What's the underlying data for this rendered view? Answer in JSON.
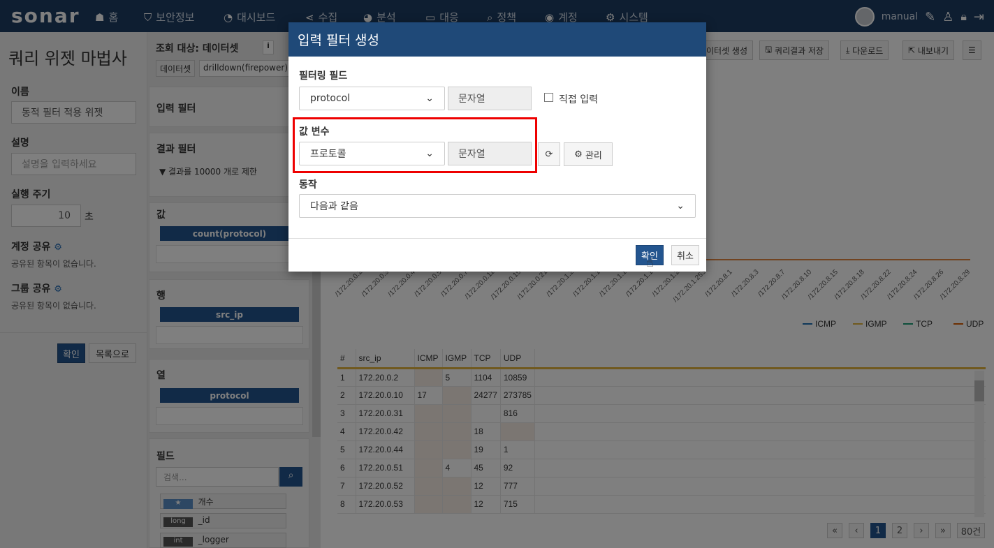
{
  "nav": {
    "logo": "sonar",
    "items": [
      {
        "label": "홈",
        "icon": "home-icon",
        "glyph": "☗"
      },
      {
        "label": "보안정보",
        "icon": "shield-icon",
        "glyph": "⛉"
      },
      {
        "label": "대시보드",
        "icon": "dashboard-icon",
        "glyph": "◔"
      },
      {
        "label": "수집",
        "icon": "share-icon",
        "glyph": "⋖"
      },
      {
        "label": "분석",
        "icon": "pie-chart-icon",
        "glyph": "◕"
      },
      {
        "label": "대응",
        "icon": "monitor-icon",
        "glyph": "▭"
      },
      {
        "label": "정책",
        "icon": "search-icon",
        "glyph": "⌕"
      },
      {
        "label": "계정",
        "icon": "user-circle-icon",
        "glyph": "◉"
      },
      {
        "label": "시스템",
        "icon": "gear-icon",
        "glyph": "⚙"
      }
    ],
    "user": "manual"
  },
  "left": {
    "title": "쿼리 위젯 마법사",
    "name_label": "이름",
    "name_value": "동적 필터 적용 위젯",
    "desc_label": "설명",
    "desc_placeholder": "설명을 입력하세요",
    "interval_label": "실행 주기",
    "interval_value": "10",
    "interval_unit": "초",
    "account_share_label": "계정 공유",
    "account_share_empty": "공유된 항목이 없습니다.",
    "group_share_label": "그룹 공유",
    "group_share_empty": "공유된 항목이 없습니다.",
    "ok_button": "확인",
    "list_button": "목록으로"
  },
  "middle": {
    "query_target_label": "조회 대상: 데이터셋",
    "dataset_tag": "데이터셋",
    "dataset_value": "drilldown(firepower)",
    "input_filter": "입력 필터",
    "result_filter": "결과 필터",
    "result_limit": "▼ 결과를 10000 개로 제한",
    "value_label": "값",
    "value_pill": "count(protocol)",
    "row_label": "행",
    "row_pill": "src_ip",
    "col_label": "열",
    "col_pill": "protocol",
    "fields_label": "필드",
    "search_placeholder": "검색...",
    "fields": [
      {
        "type": "★",
        "name": "개수"
      },
      {
        "type": "long",
        "name": "_id"
      },
      {
        "type": "int",
        "name": "_logger"
      }
    ]
  },
  "toolbar": {
    "dataset_create": "이터셋 생성",
    "save_result": "쿼리결과 저장",
    "download": "다운로드",
    "export": "내보내기"
  },
  "chart_data": {
    "type": "line",
    "x": [
      "/172.20.0.2",
      "/172.20.0.3",
      "/172.20.0.4",
      "/172.20.0.5",
      "/172.20.0.7",
      "/172.20.0.11",
      "/172.20.0.15",
      "/172.20.0.21",
      "/172.20.1.2",
      "/172.20.1.1",
      "/172.20.1.1",
      "/172.20.1.1",
      "/172.20.1.2",
      "/172.20.1.253",
      "/172.20.8.1",
      "/172.20.8.3",
      "/172.20.8.7",
      "/172.20.8.10",
      "/172.20.8.15",
      "/172.20.8.18",
      "/172.20.8.22",
      "/172.20.8.24",
      "/172.20.8.26",
      "/172.20.8.29"
    ],
    "series": [
      {
        "name": "ICMP",
        "color": "#1f6fb2"
      },
      {
        "name": "IGMP",
        "color": "#e0b23c"
      },
      {
        "name": "TCP",
        "color": "#1b9e77"
      },
      {
        "name": "UDP",
        "color": "#d95f02"
      }
    ]
  },
  "table": {
    "headers": [
      "#",
      "src_ip",
      "ICMP",
      "IGMP",
      "TCP",
      "UDP"
    ],
    "rows": [
      [
        "1",
        "172.20.0.2",
        "",
        "5",
        "1104",
        "10859"
      ],
      [
        "2",
        "172.20.0.10",
        "17",
        "",
        "24277",
        "273785"
      ],
      [
        "3",
        "172.20.0.31",
        "",
        "",
        "",
        "816"
      ],
      [
        "4",
        "172.20.0.42",
        "",
        "",
        "18",
        ""
      ],
      [
        "5",
        "172.20.0.44",
        "",
        "",
        "19",
        "1"
      ],
      [
        "6",
        "172.20.0.51",
        "",
        "4",
        "45",
        "92"
      ],
      [
        "7",
        "172.20.0.52",
        "",
        "",
        "12",
        "777"
      ],
      [
        "8",
        "172.20.0.53",
        "",
        "",
        "12",
        "715"
      ]
    ]
  },
  "pager": {
    "pages": [
      "1",
      "2"
    ],
    "total": "80건"
  },
  "modal": {
    "title": "입력 필터 생성",
    "filter_field_label": "필터링 필드",
    "filter_field_value": "protocol",
    "filter_field_type": "문자열",
    "direct_input_label": "직접 입력",
    "value_var_label": "값 변수",
    "value_var_value": "프로토콜",
    "value_var_type": "문자열",
    "manage_button": "관리",
    "action_label": "동작",
    "action_value": "다음과 같음",
    "ok_button": "확인",
    "cancel_button": "취소"
  }
}
